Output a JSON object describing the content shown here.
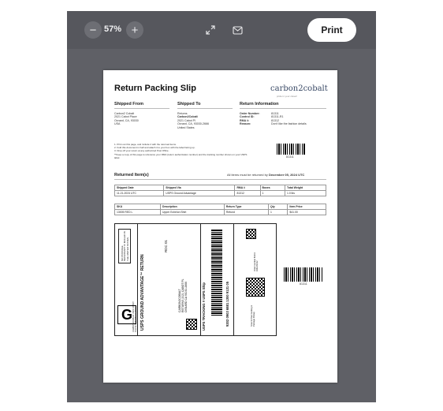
{
  "toolbar": {
    "zoom_out": "−",
    "zoom_level": "57%",
    "zoom_in": "+",
    "print_label": "Print",
    "icons": [
      "minus-icon",
      "plus-icon",
      "expand-icon",
      "mail-icon"
    ]
  },
  "doc": {
    "title": "Return Packing Slip",
    "logo": "carbon2cobalt",
    "tagline": "pride in your closet!",
    "shipped_from": {
      "heading": "Shipped From",
      "lines": [
        "Carbon2 Cobalt",
        "2021 Cabot Place",
        "Oxnard, CA, 93030",
        "USA"
      ]
    },
    "shipped_to": {
      "heading": "Shipped To",
      "lines": [
        "Returns",
        "Carbon2Cobalt",
        "2021 Cabot Pl",
        "Oxnard, CA, 93030-2666",
        "United States"
      ]
    },
    "return_info": {
      "heading": "Return Information",
      "rows": [
        {
          "label": "Order Number:",
          "value": "81311"
        },
        {
          "label": "Control ID:",
          "value": "81311-R1"
        },
        {
          "label": "RMA #:",
          "value": "81312"
        },
        {
          "label": "Reason:",
          "value": "Don't like the fashion details"
        }
      ]
    },
    "instructions": [
      "1. Print out this page, and include it with the returned items.",
      "2. Fold this document in half and attach it to your box with the label facing up.",
      "3. Drop off your return at any authorized Post Office."
    ],
    "note": "**Keep a copy of this page to reference your RMA (return authorization number) and the tracking number shown on your USPS label.",
    "barcode_number": "81311",
    "returned_items": {
      "heading": "Returned Item(s)",
      "due_text": "All items must be returned by",
      "due_date": "December 05, 2024 UTC"
    },
    "ship_table": {
      "headers": [
        "Shipped Date",
        "Shipped Via",
        "RMA #",
        "Boxes",
        "Total Weight"
      ],
      "row": [
        "11-21-2024 UTC",
        "USPS Ground Advantage",
        "81312",
        "1",
        "1.0 lbs"
      ]
    },
    "item_table": {
      "headers": [
        "SKU",
        "Description",
        "Return Type",
        "Qty",
        "Item Price"
      ],
      "row": [
        "13005 RED L",
        "Upper Echelon Shirt",
        "Refund",
        "1",
        "$41.00"
      ]
    },
    "label": {
      "postage_box": "NO POSTAGE NECESSARY IF MAILED IN THE UNITED STATES",
      "big_letter": "G",
      "service": "USPS GROUND ADVANTAGE™ RETURN",
      "route": "RDC 01",
      "sender": "CARBON2COBALT 2021 CABOT PLACE OXNARD CA 93030",
      "recipient": "CARBON2COBALT RETURNS 2021 CABOT PL OXNARD CA 93030-2666",
      "tracking_title": "USPS TRACKING # USPS Ship",
      "tracking_number": "9202 0903 6881 1300 9131 05",
      "side_text": "Order number 81311 RMA 81312",
      "scan_text": "Scan for free tracking & Package Pickup"
    },
    "side_barcode_number": "81311"
  }
}
